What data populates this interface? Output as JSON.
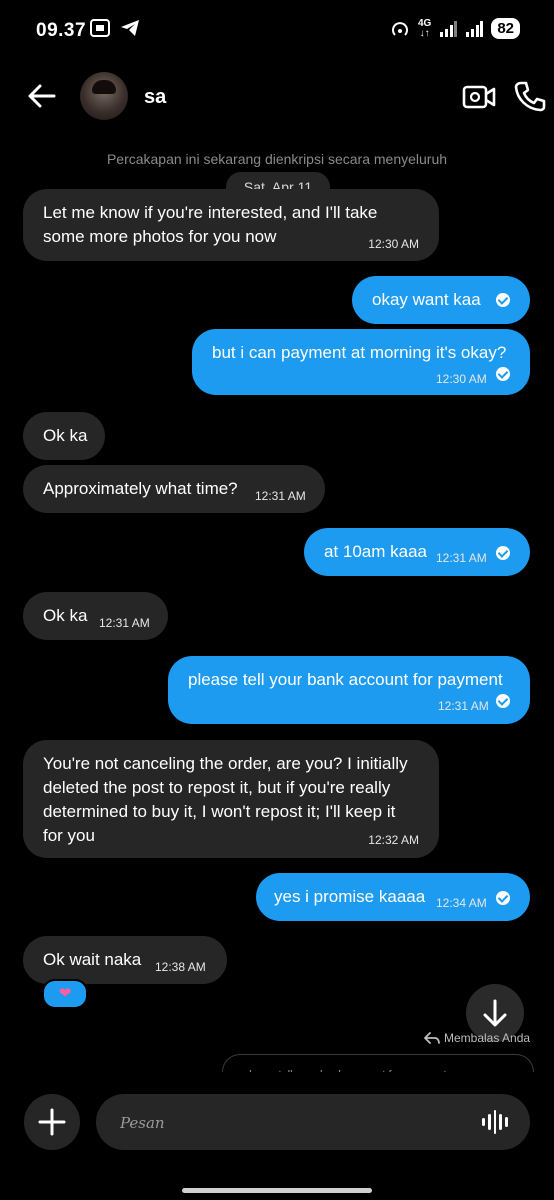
{
  "status_bar": {
    "time": "09.37",
    "network": "4G",
    "battery": "82"
  },
  "header": {
    "contact_name": "sa"
  },
  "chat": {
    "encryption_notice": "Percakapan ini sekarang dienkripsi secara menyeluruh",
    "date_label": "Sat, Apr 11",
    "messages": [
      {
        "dir": "in",
        "text_lines": [
          "Let me know if you're interested, and I'll take",
          "some more photos for you now"
        ],
        "time": "12:30 AM"
      },
      {
        "dir": "out",
        "text": "okay want kaa",
        "time": ""
      },
      {
        "dir": "out",
        "text": "but i can payment at morning it's okay?",
        "time": "12:30 AM"
      },
      {
        "dir": "in",
        "text": "Ok ka",
        "time": ""
      },
      {
        "dir": "in",
        "text": "Approximately what time?",
        "time": "12:31 AM"
      },
      {
        "dir": "out",
        "text": "at 10am kaaa",
        "time": "12:31 AM"
      },
      {
        "dir": "in",
        "text": "Ok ka",
        "time": "12:31 AM"
      },
      {
        "dir": "out",
        "text": "please tell your bank account for payment",
        "time": "12:31 AM"
      },
      {
        "dir": "in",
        "text_lines": [
          "You're not canceling the order, are you? I initially",
          "deleted the post to repost it, but if you're really",
          "determined to buy it, I won't repost it; I'll keep it",
          "for you"
        ],
        "time": "12:32 AM"
      },
      {
        "dir": "out",
        "text": "yes i promise kaaaa",
        "time": "12:34 AM"
      },
      {
        "dir": "in",
        "text": "Ok wait naka",
        "time": "12:38 AM"
      }
    ],
    "reaction": "❤",
    "reply_hint": "Membalas Anda",
    "reply_preview": "please tell your bank account for payment"
  },
  "composer": {
    "placeholder": "Pesan"
  },
  "colors": {
    "outgoing_bubble": "#1d9bf0",
    "incoming_bubble": "#262626",
    "background": "#000000"
  },
  "icons": [
    "back-arrow-icon",
    "video-call-icon",
    "phone-icon",
    "plus-icon",
    "voice-wave-icon",
    "arrow-down-icon",
    "reply-icon"
  ]
}
